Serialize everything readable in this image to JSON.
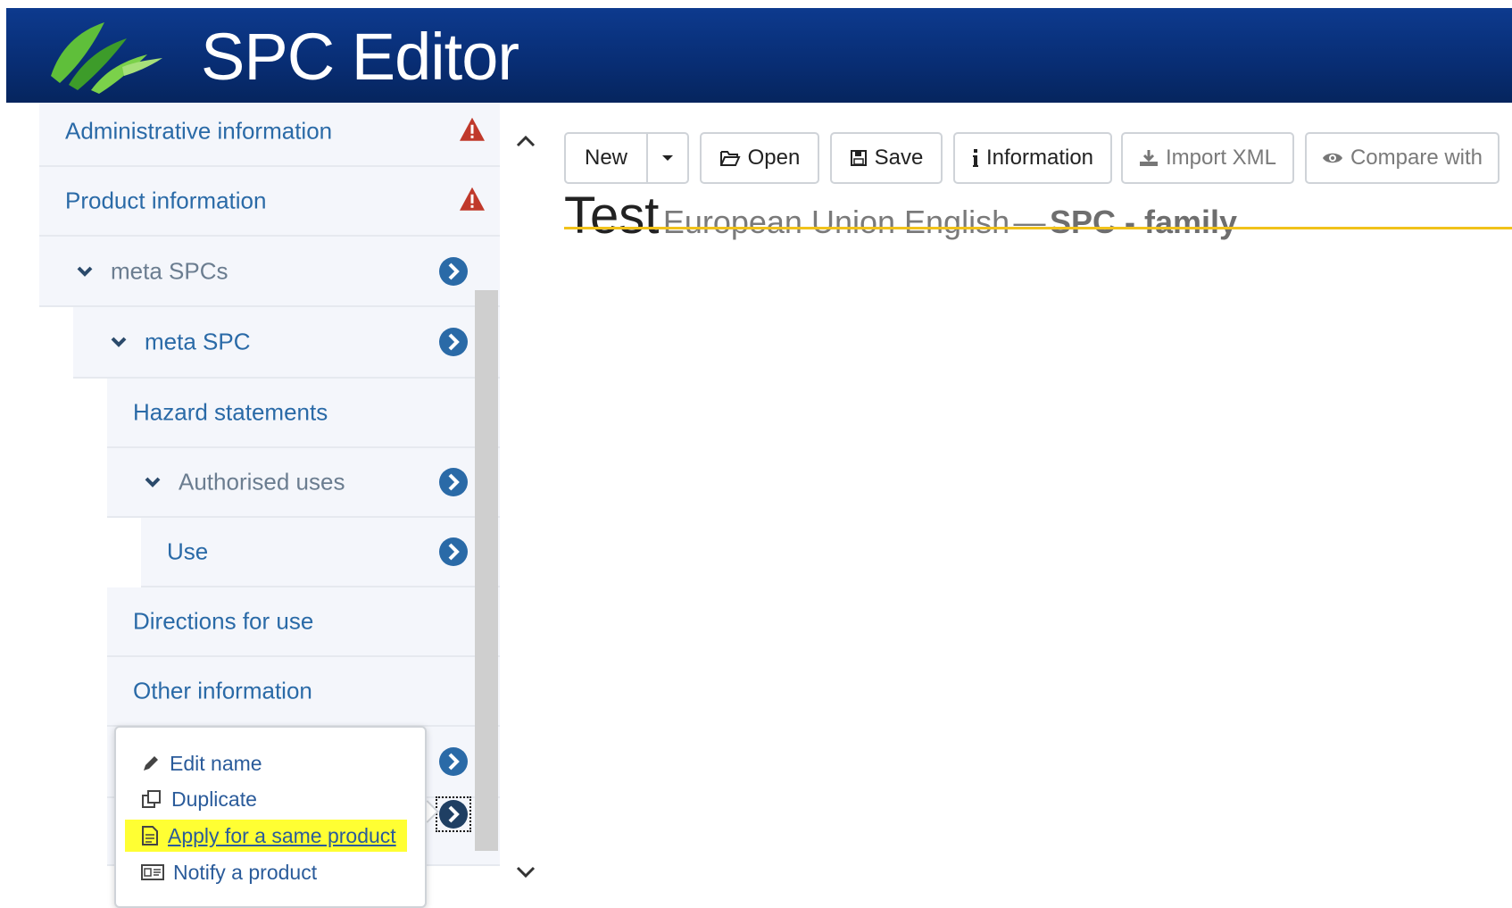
{
  "header": {
    "title": "SPC Editor",
    "logo_icon": "leaf-logo-icon"
  },
  "sidebar": {
    "items": [
      {
        "label": "Administrative information",
        "icon": "warning-icon"
      },
      {
        "label": "Product information",
        "icon": "warning-icon"
      },
      {
        "label": "meta SPCs",
        "icon": "chevron-right-circle-icon"
      },
      {
        "label": "meta SPC",
        "icon": "chevron-right-circle-icon"
      },
      {
        "label": "Hazard statements"
      },
      {
        "label": "Authorised uses",
        "icon": "chevron-right-circle-icon"
      },
      {
        "label": "Use",
        "icon": "chevron-right-circle-icon"
      },
      {
        "label": "Directions for use"
      },
      {
        "label": "Other information"
      }
    ]
  },
  "toolbar": {
    "new": "New",
    "open": "Open",
    "save": "Save",
    "information": "Information",
    "import_xml": "Import XML",
    "compare_with": "Compare with"
  },
  "document": {
    "name": "Test",
    "language": "European Union English",
    "dash": "—",
    "type": "SPC - family"
  },
  "context_menu": {
    "items": [
      {
        "label": "Edit name",
        "icon": "pencil-icon"
      },
      {
        "label": "Duplicate",
        "icon": "duplicate-icon"
      },
      {
        "label": "Apply for a same product",
        "icon": "document-icon"
      },
      {
        "label": "Notify a product",
        "icon": "id-card-icon"
      }
    ]
  },
  "colors": {
    "header": "#082d73",
    "link": "#2a6aa7",
    "highlight": "#ffff33",
    "accent_line": "#f1c21b"
  }
}
